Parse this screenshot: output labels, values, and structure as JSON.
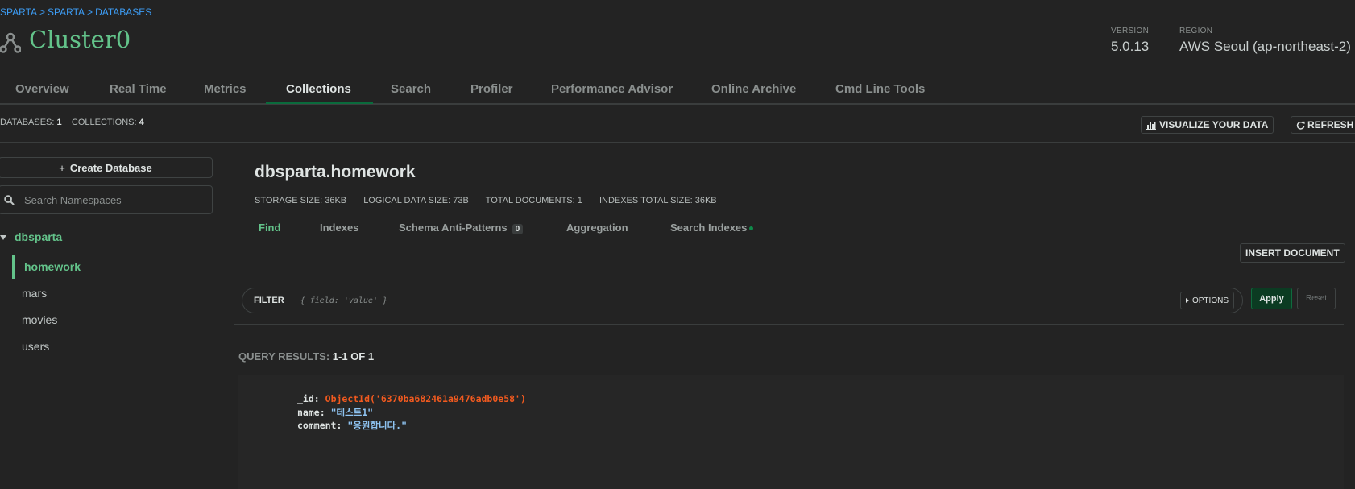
{
  "breadcrumb": [
    "SPARTA",
    "SPARTA",
    "DATABASES"
  ],
  "breadcrumb_sep": ">",
  "cluster": {
    "name": "Cluster0",
    "version_label": "VERSION",
    "version": "5.0.13",
    "region_label": "REGION",
    "region": "AWS Seoul (ap-northeast-2)"
  },
  "tabs": [
    "Overview",
    "Real Time",
    "Metrics",
    "Collections",
    "Search",
    "Profiler",
    "Performance Advisor",
    "Online Archive",
    "Cmd Line Tools"
  ],
  "active_tab": "Collections",
  "counts": {
    "databases_label": "DATABASES:",
    "databases": "1",
    "collections_label": "COLLECTIONS:",
    "collections": "4"
  },
  "header_buttons": {
    "visualize": "VISUALIZE YOUR DATA",
    "refresh": "REFRESH"
  },
  "sidebar": {
    "create_db": "Create Database",
    "search_placeholder": "Search Namespaces",
    "database": "dbsparta",
    "collections": [
      "homework",
      "mars",
      "movies",
      "users"
    ],
    "active_collection": "homework"
  },
  "namespace": {
    "title": "dbsparta.homework",
    "stats": {
      "storage": "STORAGE SIZE: 36KB",
      "logical": "LOGICAL DATA SIZE: 73B",
      "total_docs": "TOTAL DOCUMENTS: 1",
      "indexes": "INDEXES TOTAL SIZE: 36KB"
    },
    "subtabs": {
      "find": "Find",
      "indexes": "Indexes",
      "schema": "Schema Anti-Patterns",
      "schema_badge": "0",
      "aggregation": "Aggregation",
      "search_indexes": "Search Indexes"
    },
    "insert_document": "INSERT DOCUMENT"
  },
  "filter": {
    "label": "FILTER",
    "placeholder": "{ field: 'value' }",
    "options": "OPTIONS",
    "apply": "Apply",
    "reset": "Reset"
  },
  "results": {
    "label": "QUERY RESULTS:",
    "range": "1-1 OF 1"
  },
  "document": {
    "id_key": "_id:",
    "id_value": "ObjectId('6370ba682461a9476adb0e58')",
    "name_key": "name:",
    "name_value": "\"테스트1\"",
    "comment_key": "comment:",
    "comment_value": "\"응원합니다.\""
  },
  "colors": {
    "accent_green": "#63c38a",
    "link_blue": "#3d9df5",
    "objectid_orange": "#f25a1f",
    "string_blue": "#8fc4f2",
    "background": "#232323"
  }
}
